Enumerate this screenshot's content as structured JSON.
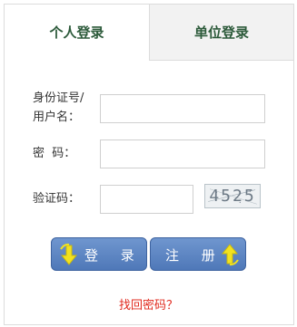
{
  "tabs": [
    {
      "label": "个人登录",
      "active": true
    },
    {
      "label": "单位登录",
      "active": false
    }
  ],
  "form": {
    "id_label_line1": "身份证号/",
    "id_label_line2": "用户名：",
    "id_value": "",
    "password_label": "密  码：",
    "password_value": "",
    "captcha_label": "验证码：",
    "captcha_value": "",
    "captcha_image_text": "4525"
  },
  "buttons": {
    "login_label": "登 录",
    "register_label": "注 册"
  },
  "links": {
    "forgot_password": "找回密码？"
  },
  "colors": {
    "tab_text": "#2c5a3a",
    "button_bg": "#5a83c3",
    "arrow_icon": "#f2e21f",
    "link": "#e02a1e"
  }
}
